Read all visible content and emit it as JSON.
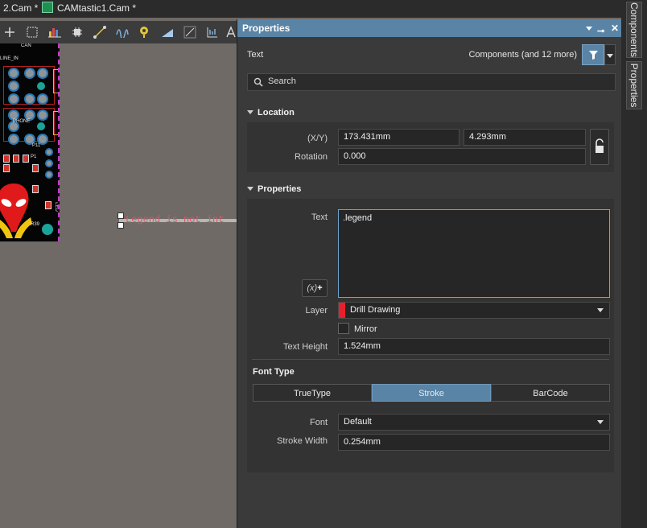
{
  "doc_tabs": [
    {
      "label": "2.Cam *"
    },
    {
      "label": "CAMtastic1.Cam *"
    }
  ],
  "toolbar": {
    "icons": [
      "crosshair-icon",
      "select-rect-icon",
      "bar-chart-icon",
      "chip-icon",
      "route-icon",
      "wave-icon",
      "place-pad-icon",
      "slope-icon",
      "line-icon",
      "dimension-icon",
      "text-icon"
    ]
  },
  "canvas": {
    "silk_labels": [
      "CAN",
      "LINE_IN",
      "PHONE",
      "P11",
      "P1",
      "R39",
      "LED"
    ],
    "legend_text": "Legend is not int"
  },
  "panel": {
    "title": "Properties",
    "object_kind": "Text",
    "filter_label": "Components (and 12 more)",
    "search_placeholder": "Search",
    "location": {
      "header": "Location",
      "xy_label": "(X/Y)",
      "x": "173.431mm",
      "y": "4.293mm",
      "rotation_label": "Rotation",
      "rotation": "0.000"
    },
    "properties": {
      "header": "Properties",
      "text_label": "Text",
      "text_value": ".legend",
      "expr_button": "(x)",
      "layer_label": "Layer",
      "layer_value": "Drill Drawing",
      "layer_color": "#e8202e",
      "mirror_label": "Mirror",
      "mirror_checked": false,
      "text_height_label": "Text Height",
      "text_height": "1.524mm",
      "font_type_label": "Font Type",
      "font_types": [
        "TrueType",
        "Stroke",
        "BarCode"
      ],
      "font_type_selected": "Stroke",
      "font_label": "Font",
      "font_value": "Default",
      "stroke_width_label": "Stroke Width",
      "stroke_width": "0.254mm"
    }
  },
  "side_tabs": [
    "Components",
    "Properties"
  ],
  "colors": {
    "panel_header": "#5a84a6",
    "selected_segment": "#5a84a6",
    "canvas_bg": "#6f6a66"
  }
}
